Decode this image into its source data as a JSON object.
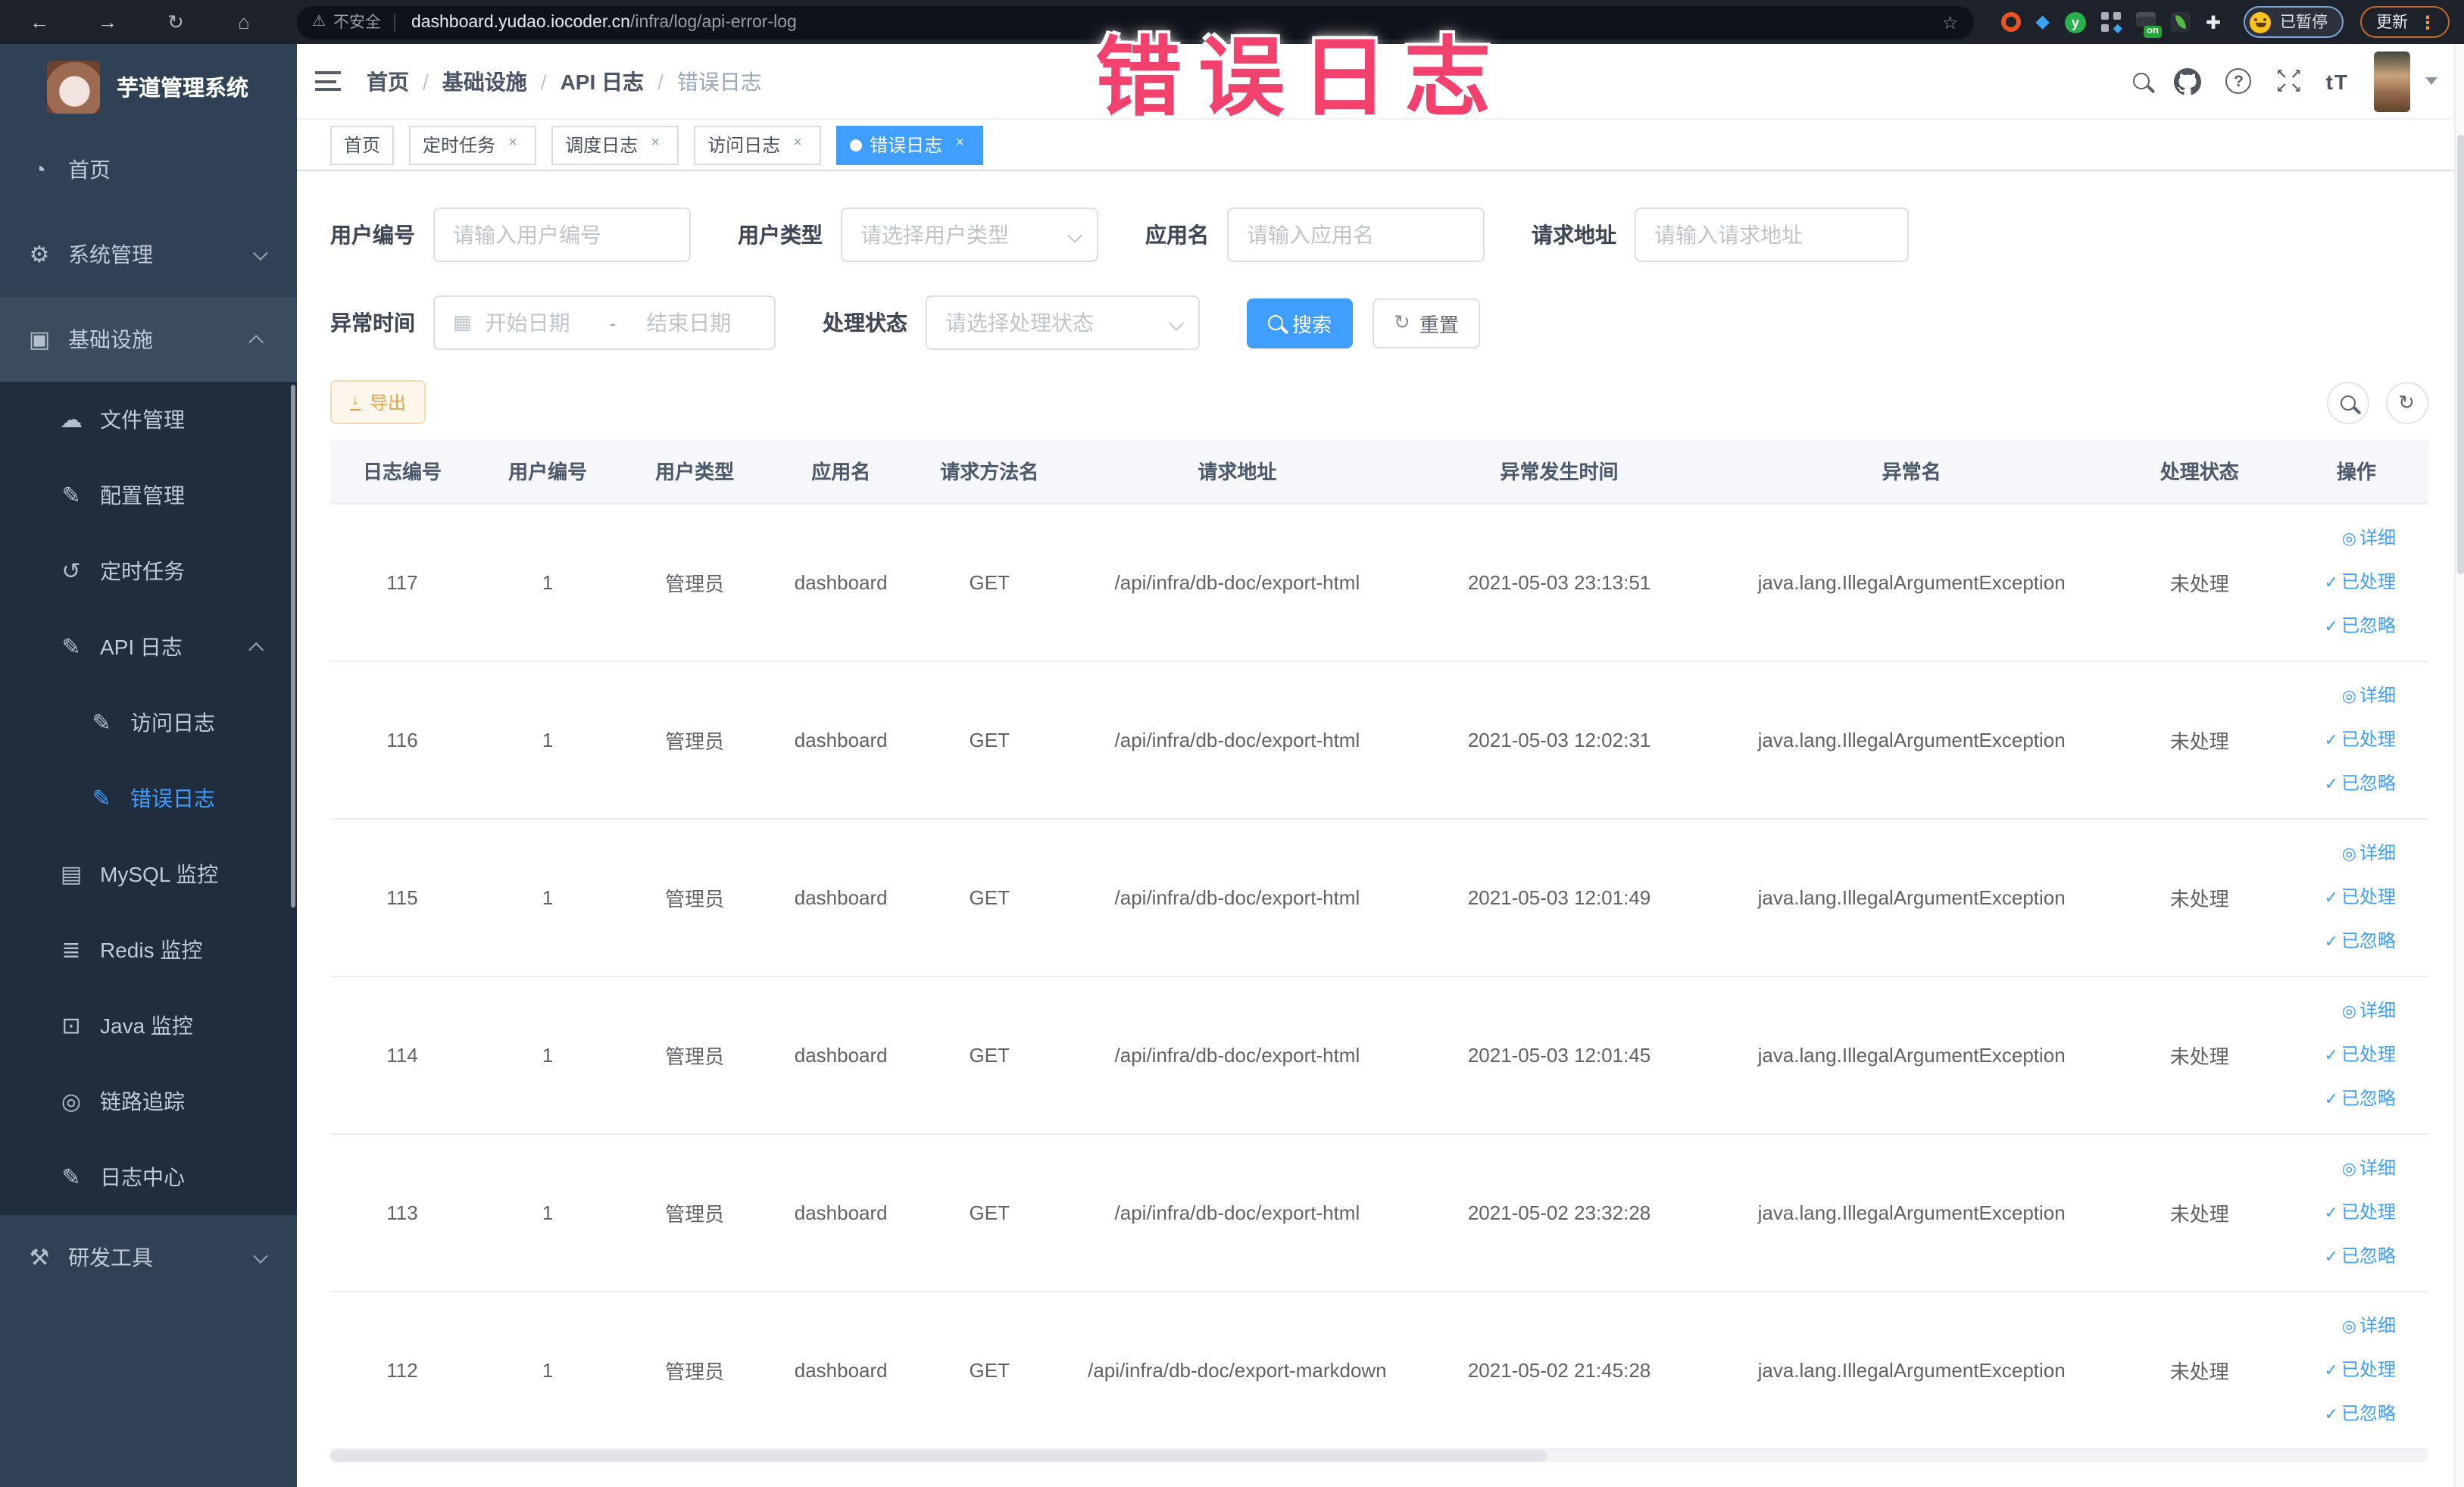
{
  "colors": {
    "accent": "#409eff",
    "warning": "#e6a23c",
    "annotation_pink": "#f1416c",
    "sidebar_bg": "#304156",
    "submenu_bg": "#1f2d3d"
  },
  "annotation": {
    "text": "错误日志"
  },
  "browser": {
    "security_label": "不安全",
    "url_host": "dashboard.yudao.iocoder.cn",
    "url_path": "/infra/log/api-error-log",
    "ext_letter": "y",
    "ext_badge": "on",
    "paused_label": "已暂停",
    "update_label": "更新"
  },
  "icons": {
    "back": "←",
    "forward": "→",
    "reload": "↻",
    "home": "⌂",
    "warning": "⚠",
    "star": "☆",
    "gem": "◆",
    "puzzle": "✚",
    "kebab": "⋮",
    "dashboard": "◔",
    "gear": "⚙",
    "monitor": "▣",
    "cloud_upload": "☁",
    "edit": "✎",
    "history": "↺",
    "chart": "▤",
    "stack": "≣",
    "desktop": "⊡",
    "eye": "◎",
    "tools": "⚒",
    "question": "?",
    "font_size": "tT",
    "arrow_nw": "↖",
    "arrow_ne": "↗",
    "arrow_sw": "↙",
    "arrow_se": "↘",
    "calendar": "▦",
    "download": "↓",
    "refresh": "↻",
    "dash": "-",
    "check": "✓",
    "detail": "◎",
    "close": "×"
  },
  "sidebar": {
    "title": "芋道管理系统",
    "menu": [
      {
        "label": "首页"
      },
      {
        "label": "系统管理"
      },
      {
        "label": "基础设施"
      },
      {
        "label": "文件管理"
      },
      {
        "label": "配置管理"
      },
      {
        "label": "定时任务"
      },
      {
        "label": "API 日志"
      },
      {
        "label": "访问日志"
      },
      {
        "label": "错误日志"
      },
      {
        "label": "MySQL 监控"
      },
      {
        "label": "Redis 监控"
      },
      {
        "label": "Java 监控"
      },
      {
        "label": "链路追踪"
      },
      {
        "label": "日志中心"
      },
      {
        "label": "研发工具"
      }
    ]
  },
  "breadcrumb": {
    "separator": "/",
    "items": [
      "首页",
      "基础设施",
      "API 日志",
      "错误日志"
    ]
  },
  "tags": [
    {
      "label": "首页"
    },
    {
      "label": "定时任务"
    },
    {
      "label": "调度日志"
    },
    {
      "label": "访问日志"
    },
    {
      "label": "错误日志"
    }
  ],
  "filters": {
    "user_id": {
      "label": "用户编号",
      "placeholder": "请输入用户编号"
    },
    "user_type": {
      "label": "用户类型",
      "placeholder": "请选择用户类型"
    },
    "app_name": {
      "label": "应用名",
      "placeholder": "请输入应用名"
    },
    "request_url": {
      "label": "请求地址",
      "placeholder": "请输入请求地址"
    },
    "exception_time": {
      "label": "异常时间",
      "start_placeholder": "开始日期",
      "separator": "-",
      "end_placeholder": "结束日期"
    },
    "process_status": {
      "label": "处理状态",
      "placeholder": "请选择处理状态"
    },
    "search_label": "搜索",
    "reset_label": "重置"
  },
  "toolbar": {
    "export_label": "导出"
  },
  "table": {
    "columns": [
      "日志编号",
      "用户编号",
      "用户类型",
      "应用名",
      "请求方法名",
      "请求地址",
      "异常发生时间",
      "异常名",
      "处理状态",
      "操作"
    ],
    "actions": [
      "详细",
      "已处理",
      "已忽略"
    ],
    "rows": [
      {
        "id": "117",
        "user_id": "1",
        "user_type": "管理员",
        "app": "dashboard",
        "method": "GET",
        "url": "/api/infra/db-doc/export-html",
        "time": "2021-05-03 23:13:51",
        "exception": "java.lang.IllegalArgumentException",
        "status": "未处理"
      },
      {
        "id": "116",
        "user_id": "1",
        "user_type": "管理员",
        "app": "dashboard",
        "method": "GET",
        "url": "/api/infra/db-doc/export-html",
        "time": "2021-05-03 12:02:31",
        "exception": "java.lang.IllegalArgumentException",
        "status": "未处理"
      },
      {
        "id": "115",
        "user_id": "1",
        "user_type": "管理员",
        "app": "dashboard",
        "method": "GET",
        "url": "/api/infra/db-doc/export-html",
        "time": "2021-05-03 12:01:49",
        "exception": "java.lang.IllegalArgumentException",
        "status": "未处理"
      },
      {
        "id": "114",
        "user_id": "1",
        "user_type": "管理员",
        "app": "dashboard",
        "method": "GET",
        "url": "/api/infra/db-doc/export-html",
        "time": "2021-05-03 12:01:45",
        "exception": "java.lang.IllegalArgumentException",
        "status": "未处理"
      },
      {
        "id": "113",
        "user_id": "1",
        "user_type": "管理员",
        "app": "dashboard",
        "method": "GET",
        "url": "/api/infra/db-doc/export-html",
        "time": "2021-05-02 23:32:28",
        "exception": "java.lang.IllegalArgumentException",
        "status": "未处理"
      },
      {
        "id": "112",
        "user_id": "1",
        "user_type": "管理员",
        "app": "dashboard",
        "method": "GET",
        "url": "/api/infra/db-doc/export-markdown",
        "time": "2021-05-02 21:45:28",
        "exception": "java.lang.IllegalArgumentException",
        "status": "未处理"
      }
    ]
  }
}
